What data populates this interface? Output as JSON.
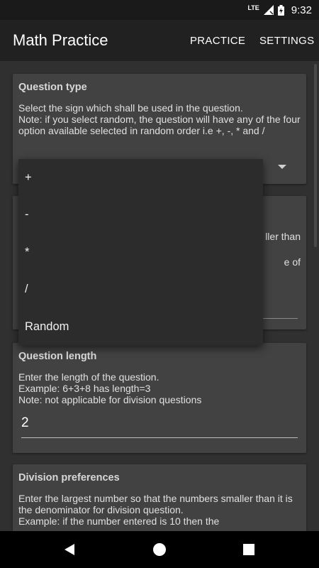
{
  "status_bar": {
    "network": "LTE",
    "time": "9:32"
  },
  "app_bar": {
    "title": "Math Practice",
    "actions": [
      "PRACTICE",
      "SETTINGS"
    ]
  },
  "cards": {
    "question_type": {
      "title": "Question type",
      "description": "Select the sign which shall be used in the question.\nNote: if you select random, the question will have any of the four option available selected in random order i.e +, -, * and /"
    },
    "range": {
      "partial_lines": [
        "ller than",
        "e of"
      ]
    },
    "question_length": {
      "title": "Question length",
      "description": "Enter the length of the question.\nExample: 6+3+8 has length=3\nNote: not applicable for division questions",
      "value": "2"
    },
    "division_preferences": {
      "title": "Division preferences",
      "description": "Enter the largest number so that the numbers smaller than it is the denominator for division question.\nExample: if the number entered is 10 then the"
    }
  },
  "dropdown": {
    "options": [
      "+",
      "-",
      "*",
      "/",
      "Random"
    ]
  },
  "nav_bar": {
    "icons": [
      "back-icon",
      "home-icon",
      "recents-icon"
    ]
  }
}
